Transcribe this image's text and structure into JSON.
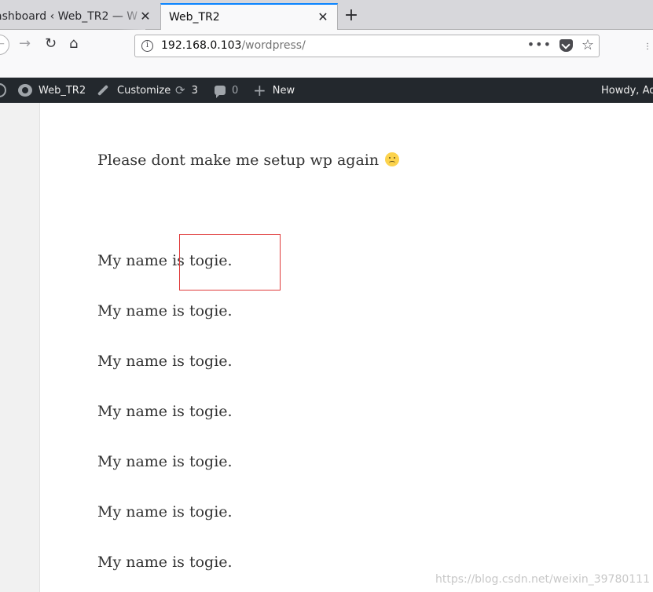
{
  "browser": {
    "tabs": [
      {
        "title": "ashboard ‹ Web_TR2 — W",
        "active": false
      },
      {
        "title": "Web_TR2",
        "active": true
      }
    ],
    "close_glyph": "✕",
    "newtab_glyph": "+",
    "url": {
      "host": "192.168.0.103",
      "path": "/wordpress/"
    },
    "icons": {
      "back": "arrow-left-icon",
      "forward": "arrow-right-icon",
      "reload": "reload-icon",
      "home": "home-icon",
      "info": "info-icon",
      "more": "more-actions-icon",
      "pocket": "pocket-icon",
      "bookmark": "star-icon"
    }
  },
  "adminbar": {
    "site_name": "Web_TR2",
    "customize": "Customize",
    "updates_count": "3",
    "comments_count": "0",
    "new_label": "New",
    "howdy": "Howdy, Adr",
    "bg_color": "#23282d"
  },
  "post": {
    "intro": "Please dont make me setup wp again",
    "lines": [
      "My name is togie.",
      "My name is togie.",
      "My name is togie.",
      "My name is togie.",
      "My name is togie.",
      "My name is togie.",
      "My name is togie."
    ]
  },
  "watermark": "https://blog.csdn.net/weixin_39780111",
  "colors": {
    "accent": "#0a84ff",
    "highlight_box": "#e03a3a"
  }
}
